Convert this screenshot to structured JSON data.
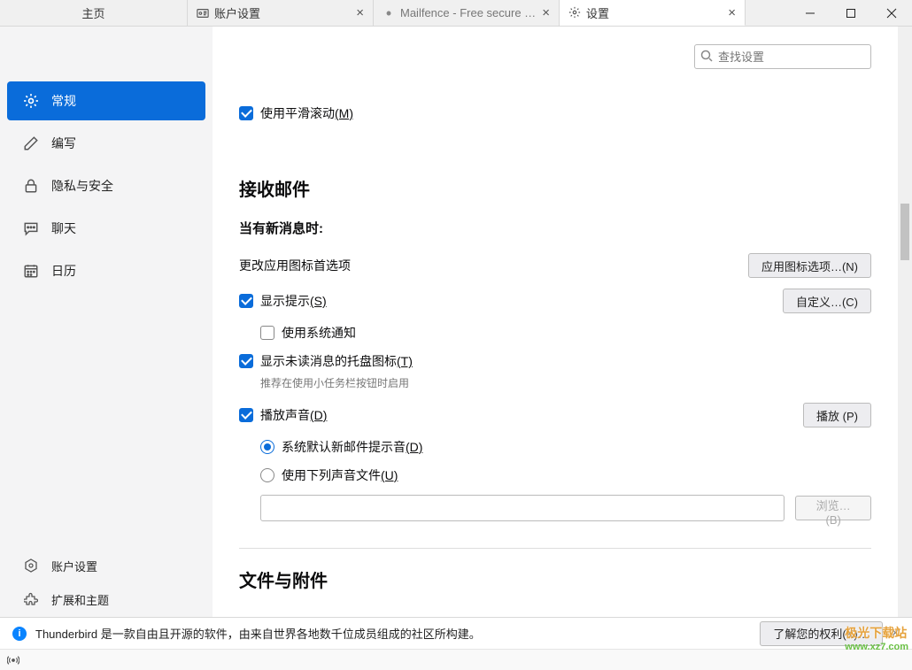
{
  "titlebar": {
    "home": "主页",
    "tabs": [
      {
        "label": "账户设置",
        "icon": "account"
      },
      {
        "label": "Mailfence - Free secure email",
        "icon": "dot"
      },
      {
        "label": "设置",
        "icon": "gear"
      }
    ]
  },
  "sidebar": {
    "items": [
      {
        "label": "常规",
        "icon": "gear",
        "active": true
      },
      {
        "label": "编写",
        "icon": "pencil"
      },
      {
        "label": "隐私与安全",
        "icon": "lock"
      },
      {
        "label": "聊天",
        "icon": "chat"
      },
      {
        "label": "日历",
        "icon": "calendar"
      }
    ],
    "bottom": [
      {
        "label": "账户设置",
        "icon": "hex"
      },
      {
        "label": "扩展和主题",
        "icon": "puzzle"
      }
    ]
  },
  "search": {
    "placeholder": "查找设置"
  },
  "smooth_scroll": {
    "label": "使用平滑滚动",
    "access": "(M)"
  },
  "section_incoming": {
    "title": "接收邮件",
    "subtitle": "当有新消息时:",
    "icon_pref_label": "更改应用图标首选项",
    "icon_pref_btn": "应用图标选项…(N)",
    "show_alert": {
      "label": "显示提示",
      "access": "(S)"
    },
    "customize_btn": "自定义…(C)",
    "use_system_notif": "使用系统通知",
    "tray_icon": {
      "label": "显示未读消息的托盘图标",
      "access": "(T)"
    },
    "tray_hint": "推荐在使用小任务栏按钮时启用",
    "play_sound": {
      "label": "播放声音",
      "access": "(D)"
    },
    "play_btn": "播放 (P)",
    "radio_default": {
      "label": "系统默认新邮件提示音",
      "access": "(D)"
    },
    "radio_file": {
      "label": "使用下列声音文件",
      "access": "(U)"
    },
    "browse_btn": "浏览…(B)"
  },
  "section_files": {
    "title": "文件与附件"
  },
  "banner": {
    "text": "Thunderbird 是一款自由且开源的软件，由来自世界各地数千位成员组成的社区所构建。",
    "button": "了解您的权利(K)…"
  },
  "watermark": {
    "line1": "极光下载站",
    "line2": "www.xz7.com"
  }
}
